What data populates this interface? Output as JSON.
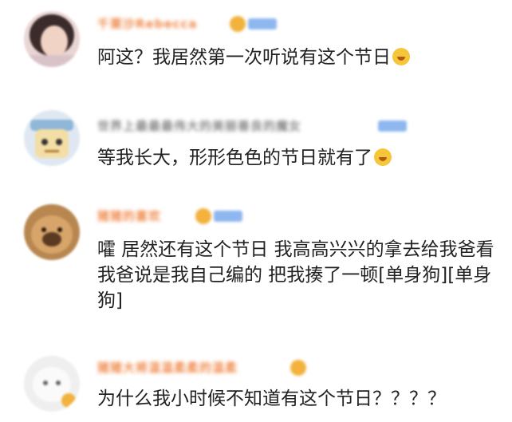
{
  "comments": [
    {
      "username": "千栗沙Rebecca",
      "username_color": "#f08a4b",
      "text": "阿这？我居然第一次听说有这个节日",
      "emoji": "laughing-crying-emoji",
      "avatar": "girl-photo-avatar"
    },
    {
      "username": "世界上最最最伟大的美丽善良的魔女",
      "username_color": "#8a8a8a",
      "text": "等我长大，形形色色的节日就有了",
      "emoji": "hug-emoji",
      "avatar": "cartoon-avatar"
    },
    {
      "username": "猪猪的喜欢",
      "username_color": "#f08a4b",
      "text": "嚯 居然还有这个节日 我高高兴兴的拿去给我爸看 我爸说是我自己编的 把我揍了一顿[单身狗][单身狗]",
      "emoji": "",
      "avatar": "dog-photo-avatar"
    },
    {
      "username": "猪猪大将温温柔柔的温柔",
      "username_color": "#f08a4b",
      "text": "为什么我小时候不知道有这个节日？？？？",
      "emoji": "",
      "avatar": "white-character-avatar"
    }
  ]
}
